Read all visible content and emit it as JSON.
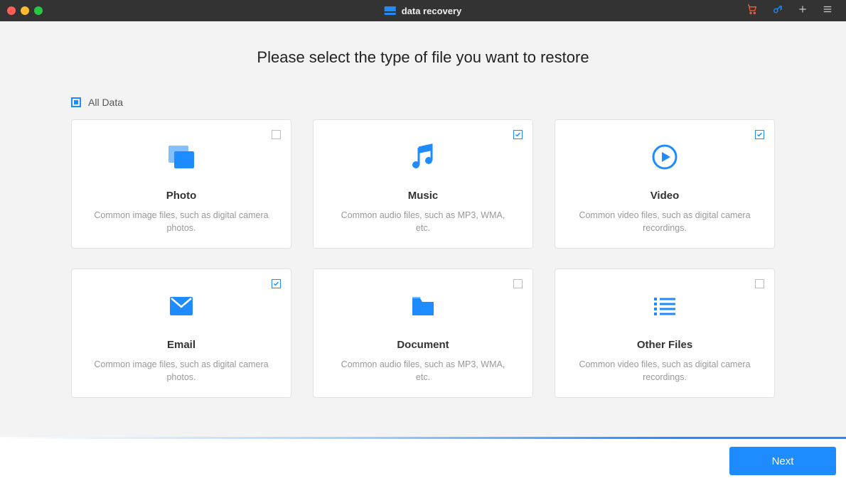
{
  "app": {
    "title": "data recovery"
  },
  "header": {
    "heading": "Please select the type of file you want to restore"
  },
  "all_data": {
    "label": "All Data",
    "state": "mixed"
  },
  "cards": [
    {
      "id": "photo",
      "title": "Photo",
      "desc": "Common image files, such as digital camera photos.",
      "checked": false,
      "icon": "photo"
    },
    {
      "id": "music",
      "title": "Music",
      "desc": "Common audio files, such as MP3, WMA, etc.",
      "checked": true,
      "icon": "music"
    },
    {
      "id": "video",
      "title": "Video",
      "desc": "Common video files, such as digital camera recordings.",
      "checked": true,
      "icon": "video"
    },
    {
      "id": "email",
      "title": "Email",
      "desc": "Common image files, such as digital camera photos.",
      "checked": true,
      "icon": "email"
    },
    {
      "id": "document",
      "title": "Document",
      "desc": "Common audio files, such as MP3, WMA, etc.",
      "checked": false,
      "icon": "document"
    },
    {
      "id": "other",
      "title": "Other Files",
      "desc": "Common video files, such as digital camera recordings.",
      "checked": false,
      "icon": "other"
    }
  ],
  "footer": {
    "next_label": "Next"
  },
  "colors": {
    "accent": "#1e8bff"
  }
}
